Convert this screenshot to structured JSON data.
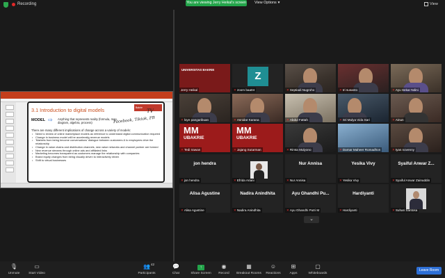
{
  "topbar": {
    "recording_label": "Recording",
    "viewing_banner": "You are viewing Jerry Heikal's screen",
    "view_options_label": "View Options",
    "view_label": "View"
  },
  "slide": {
    "title": "3.1 Introduction to digital models",
    "logo_text": "Bakrie",
    "model_label": "MODEL",
    "definition": "Anything that represents reality (formula, map, diagram, algebra, process)",
    "intro_line": "There are many different implications of change across a variety of models:",
    "bullets": [
      "Need to review of online marketplace models as reference to understand digital communication required",
      "Change in business model will be acceleratig revenue models",
      "'Markets from being become conversations' dialogue between customers & to employees drive the relationship",
      "Change in value chains and distribution channels, new value networks and channel partner are formed",
      "New revenue streams through online ads and affiliated links",
      "Marketing becomes transparent as customers manage the relationship with companies",
      "Brand equity changes from being visually driven to interactively driven",
      "Shift to virtual businesses"
    ],
    "ink_notes": [
      "TV",
      "Facebook, Tiktok, FB"
    ]
  },
  "participants": [
    {
      "name": "Jerry Heikal",
      "muted": false,
      "tile": "uni-banner",
      "banner_text": "UNIVERSITAS BAKRIE"
    },
    {
      "name": "zoom baa04",
      "muted": true,
      "tile": "z-logo",
      "logo": "Z"
    },
    {
      "name": "Septiadi Nugroho",
      "muted": true,
      "tile": "photo"
    },
    {
      "name": "tri susanto",
      "muted": true,
      "tile": "photo"
    },
    {
      "name": "Ayu Sekar Ndini",
      "muted": true,
      "tile": "photo"
    },
    {
      "name": "loye pangaribuan",
      "muted": true,
      "tile": "photo"
    },
    {
      "name": "Asnidar Karana",
      "muted": true,
      "tile": "photo"
    },
    {
      "name": "Abdul Fattah",
      "muted": true,
      "tile": "photo"
    },
    {
      "name": "Sri Mulya Vida Sari",
      "muted": true,
      "tile": "photo"
    },
    {
      "name": "Ainun",
      "muted": true,
      "tile": "photo"
    },
    {
      "name": "Tedi Irawan",
      "muted": true,
      "tile": "mm",
      "mm_text": "MM",
      "mm_sub": "UBAKRIE"
    },
    {
      "name": "Jajang Sutarman",
      "muted": true,
      "tile": "mm",
      "mm_text": "MM",
      "mm_sub": "UBAKRIE"
    },
    {
      "name": "Rimta Mulyono",
      "muted": true,
      "tile": "photo"
    },
    {
      "name": "Damar Maheer Romadhon",
      "muted": true,
      "tile": "photo"
    },
    {
      "name": "tyas novenny",
      "muted": true,
      "tile": "photo"
    },
    {
      "name": "jon hendra",
      "muted": true,
      "tile": "name",
      "display": "jon hendra"
    },
    {
      "name": "Efrida Ariani",
      "muted": true,
      "tile": "small-video"
    },
    {
      "name": "Nur Annisa",
      "muted": true,
      "tile": "name",
      "display": "Nur Annisa"
    },
    {
      "name": "Yesika Vivy",
      "muted": true,
      "tile": "name",
      "display": "Yesika Vivy"
    },
    {
      "name": "Syaiful Anwar Zainuddin",
      "muted": true,
      "tile": "name",
      "display": "Syaiful Anwar Z..."
    },
    {
      "name": "Alisa Agustine",
      "muted": true,
      "tile": "name",
      "display": "Alisa Agustine"
    },
    {
      "name": "Nadira Anindhita",
      "muted": true,
      "tile": "name",
      "display": "Nadira Anindhita"
    },
    {
      "name": "Ayu Ghandhi Putri M",
      "muted": true,
      "tile": "name",
      "display": "Ayu Ghandhi Pu..."
    },
    {
      "name": "Hardiyanti",
      "muted": true,
      "tile": "name",
      "display": "Hardiyanti"
    },
    {
      "name": "Suhari Santosa",
      "muted": true,
      "tile": "small-video2"
    }
  ],
  "toolbar": {
    "unmute": "Unmute",
    "start_video": "Start Video",
    "participants": "Participants",
    "participants_count": "42",
    "chat": "Chat",
    "share_screen": "Share Screen",
    "record": "Record",
    "breakout_rooms": "Breakout Rooms",
    "reactions": "Reactions",
    "apps": "Apps",
    "whiteboards": "Whiteboards",
    "leave": "Leave Room"
  }
}
